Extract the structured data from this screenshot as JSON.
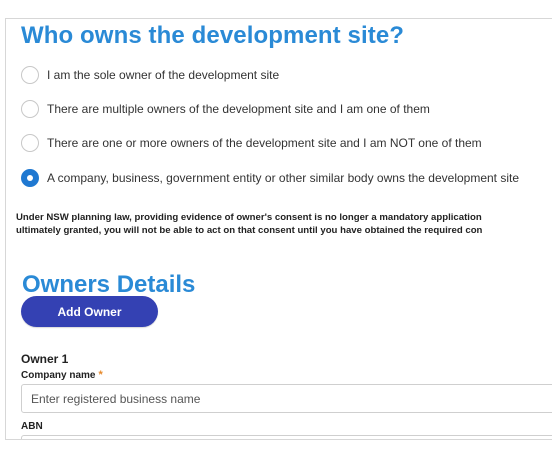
{
  "page": {
    "title": "Who owns the development site?",
    "ownership_options": [
      {
        "label": "I am the sole owner of the development site",
        "selected": false
      },
      {
        "label": "There are multiple owners of the development site and I am one of them",
        "selected": false
      },
      {
        "label": "There are one or more owners of the development site and I am NOT one of them",
        "selected": false
      },
      {
        "label": "A company, business, government entity or other similar body owns the development site",
        "selected": true
      }
    ],
    "notice_line1": "Under NSW planning law, providing evidence of owner's consent is no longer a mandatory application",
    "notice_line2": "ultimately granted, you will not be able to act on that consent until you have obtained the required con"
  },
  "owners": {
    "section_title": "Owners Details",
    "add_owner_label": "Add Owner",
    "owner_heading": "Owner 1",
    "company_name_label": "Company name",
    "company_name_required_marker": "*",
    "company_name_placeholder": "Enter registered business name",
    "company_name_value": "",
    "abn_label": "ABN"
  },
  "colors": {
    "heading": "#2a8ad6",
    "button": "#3441b3",
    "radio_selected": "#1f78d1",
    "required": "#e6892b"
  }
}
